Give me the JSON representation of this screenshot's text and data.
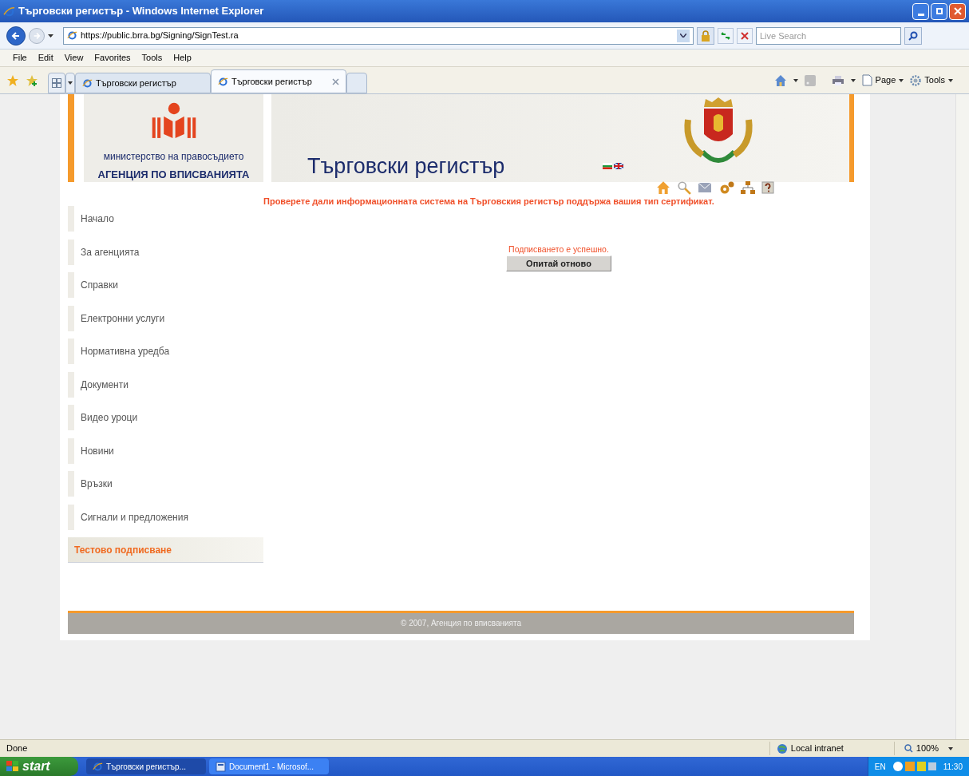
{
  "window": {
    "title": "Търговски регистър - Windows Internet Explorer"
  },
  "address_bar": {
    "url": "https://public.brra.bg/Signing/SignTest.ra",
    "search_placeholder": "Live Search"
  },
  "menu": [
    "File",
    "Edit",
    "View",
    "Favorites",
    "Tools",
    "Help"
  ],
  "tabs": [
    {
      "label": "Търговски регистър",
      "selected": false
    },
    {
      "label": "Търговски регистър",
      "selected": true
    }
  ],
  "command_bar": [
    "Page",
    "Tools"
  ],
  "header": {
    "ministry": "министерство на правосъдието",
    "agency": "АГЕНЦИЯ ПО ВПИСВАНИЯТА",
    "site_title": "Търговски регистър"
  },
  "nav": [
    {
      "label": "Начало",
      "selected": false
    },
    {
      "label": "За агенцията",
      "selected": false
    },
    {
      "label": "Справки",
      "selected": false
    },
    {
      "label": "Електронни услуги",
      "selected": false
    },
    {
      "label": "Нормативна уредба",
      "selected": false
    },
    {
      "label": "Документи",
      "selected": false
    },
    {
      "label": "Видео уроци",
      "selected": false
    },
    {
      "label": "Новини",
      "selected": false
    },
    {
      "label": "Връзки",
      "selected": false
    },
    {
      "label": "Сигнали и предложения",
      "selected": false
    },
    {
      "label": "Тестово подписване",
      "selected": true
    }
  ],
  "notice": "Проверете дали информационната система на Търговския регистър поддържа вашия тип сертификат.",
  "result_message": "Подписването е успешно.",
  "retry_button": "Опитай отново",
  "footer": "© 2007, Агенция по вписванията",
  "status_bar": {
    "status": "Done",
    "zone": "Local intranet",
    "zoom": "100%"
  },
  "taskbar": {
    "start": "start",
    "tasks": [
      {
        "label": "Търговски регистър...",
        "selected": true
      },
      {
        "label": "Document1 - Microsof...",
        "selected": false
      }
    ],
    "language": "EN",
    "clock": "11:30"
  }
}
